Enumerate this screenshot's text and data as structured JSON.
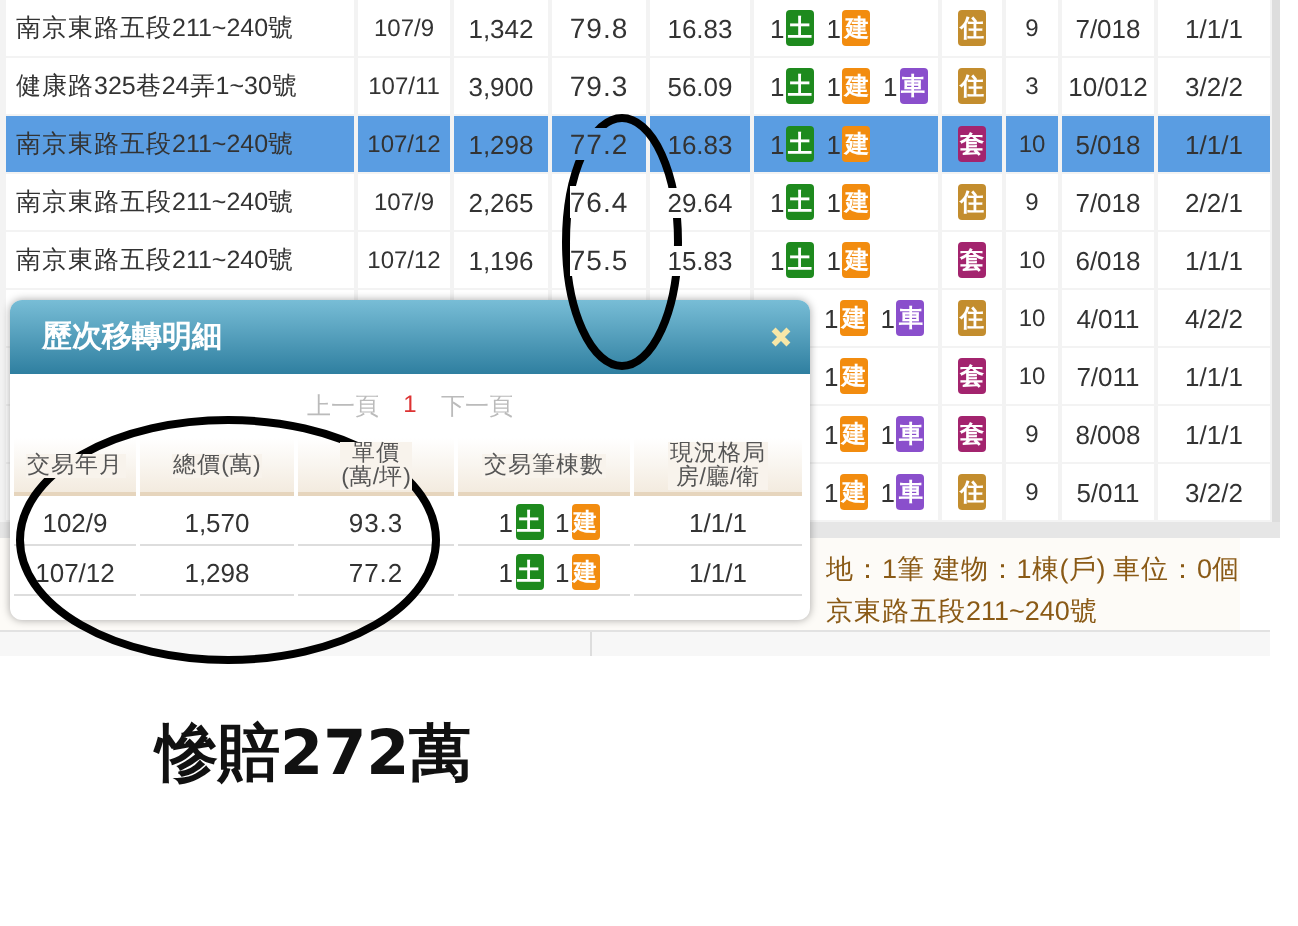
{
  "listing_table": {
    "rows": [
      {
        "address": "南京東路五段211~240號",
        "date": "107/9",
        "total": "1,342",
        "unit_price": "79.8",
        "area": "16.83",
        "counts": [
          {
            "count": "1",
            "label": "土",
            "kind": "land"
          },
          {
            "count": "1",
            "label": "建",
            "kind": "building"
          }
        ],
        "type": {
          "label": "住",
          "kind": "residence"
        },
        "floors": "9",
        "floor": "7/018",
        "layout": "1/1/1",
        "selected": false
      },
      {
        "address": "健康路325巷24弄1~30號",
        "date": "107/11",
        "total": "3,900",
        "unit_price": "79.3",
        "area": "56.09",
        "counts": [
          {
            "count": "1",
            "label": "土",
            "kind": "land"
          },
          {
            "count": "1",
            "label": "建",
            "kind": "building"
          },
          {
            "count": "1",
            "label": "車",
            "kind": "parking"
          }
        ],
        "type": {
          "label": "住",
          "kind": "residence"
        },
        "floors": "3",
        "floor": "10/012",
        "layout": "3/2/2",
        "selected": false
      },
      {
        "address": "南京東路五段211~240號",
        "date": "107/12",
        "total": "1,298",
        "unit_price": "77.2",
        "area": "16.83",
        "counts": [
          {
            "count": "1",
            "label": "土",
            "kind": "land"
          },
          {
            "count": "1",
            "label": "建",
            "kind": "building"
          }
        ],
        "type": {
          "label": "套",
          "kind": "suite"
        },
        "floors": "10",
        "floor": "5/018",
        "layout": "1/1/1",
        "selected": true
      },
      {
        "address": "南京東路五段211~240號",
        "date": "107/9",
        "total": "2,265",
        "unit_price": "76.4",
        "area": "29.64",
        "counts": [
          {
            "count": "1",
            "label": "土",
            "kind": "land"
          },
          {
            "count": "1",
            "label": "建",
            "kind": "building"
          }
        ],
        "type": {
          "label": "住",
          "kind": "residence"
        },
        "floors": "9",
        "floor": "7/018",
        "layout": "2/2/1",
        "selected": false
      },
      {
        "address": "南京東路五段211~240號",
        "date": "107/12",
        "total": "1,196",
        "unit_price": "75.5",
        "area": "15.83",
        "counts": [
          {
            "count": "1",
            "label": "土",
            "kind": "land"
          },
          {
            "count": "1",
            "label": "建",
            "kind": "building"
          }
        ],
        "type": {
          "label": "套",
          "kind": "suite"
        },
        "floors": "10",
        "floor": "6/018",
        "layout": "1/1/1",
        "selected": false
      },
      {
        "counts": [
          {
            "count": "1",
            "label": "建",
            "kind": "building"
          },
          {
            "count": "1",
            "label": "車",
            "kind": "parking"
          }
        ],
        "type": {
          "label": "住",
          "kind": "residence"
        },
        "floors": "10",
        "floor": "4/011",
        "layout": "4/2/2",
        "selected": false
      },
      {
        "counts": [
          {
            "count": "1",
            "label": "建",
            "kind": "building"
          }
        ],
        "type": {
          "label": "套",
          "kind": "suite"
        },
        "floors": "10",
        "floor": "7/011",
        "layout": "1/1/1",
        "selected": false
      },
      {
        "counts": [
          {
            "count": "1",
            "label": "建",
            "kind": "building"
          },
          {
            "count": "1",
            "label": "車",
            "kind": "parking"
          }
        ],
        "type": {
          "label": "套",
          "kind": "suite"
        },
        "floors": "9",
        "floor": "8/008",
        "layout": "1/1/1",
        "selected": false
      },
      {
        "counts": [
          {
            "count": "1",
            "label": "建",
            "kind": "building"
          },
          {
            "count": "1",
            "label": "車",
            "kind": "parking"
          }
        ],
        "type": {
          "label": "住",
          "kind": "residence"
        },
        "floors": "9",
        "floor": "5/011",
        "layout": "3/2/2",
        "selected": false
      }
    ]
  },
  "detail_panel": {
    "lines": [
      "地：1筆 建物：1棟(戶) 車位：0個",
      "京東路五段211~240號"
    ]
  },
  "transfer_popup": {
    "title": "歷次移轉明細",
    "pager": {
      "prev": "上一頁",
      "pages": [
        {
          "label": "1",
          "selected": true
        }
      ],
      "next": "下一頁"
    },
    "columns": [
      [
        "交易年月"
      ],
      [
        "總價(萬)"
      ],
      [
        "單價",
        "(萬/坪)"
      ],
      [
        "交易筆棟數"
      ],
      [
        "現況格局",
        "房/廳/衛"
      ]
    ],
    "rows": [
      {
        "date": "102/9",
        "total": "1,570",
        "unit_price": "93.3",
        "counts": [
          {
            "count": "1",
            "label": "土",
            "kind": "land"
          },
          {
            "count": "1",
            "label": "建",
            "kind": "building"
          }
        ],
        "layout": "1/1/1"
      },
      {
        "date": "107/12",
        "total": "1,298",
        "unit_price": "77.2",
        "counts": [
          {
            "count": "1",
            "label": "土",
            "kind": "land"
          },
          {
            "count": "1",
            "label": "建",
            "kind": "building"
          }
        ],
        "layout": "1/1/1"
      }
    ]
  },
  "caption": "慘賠272萬"
}
